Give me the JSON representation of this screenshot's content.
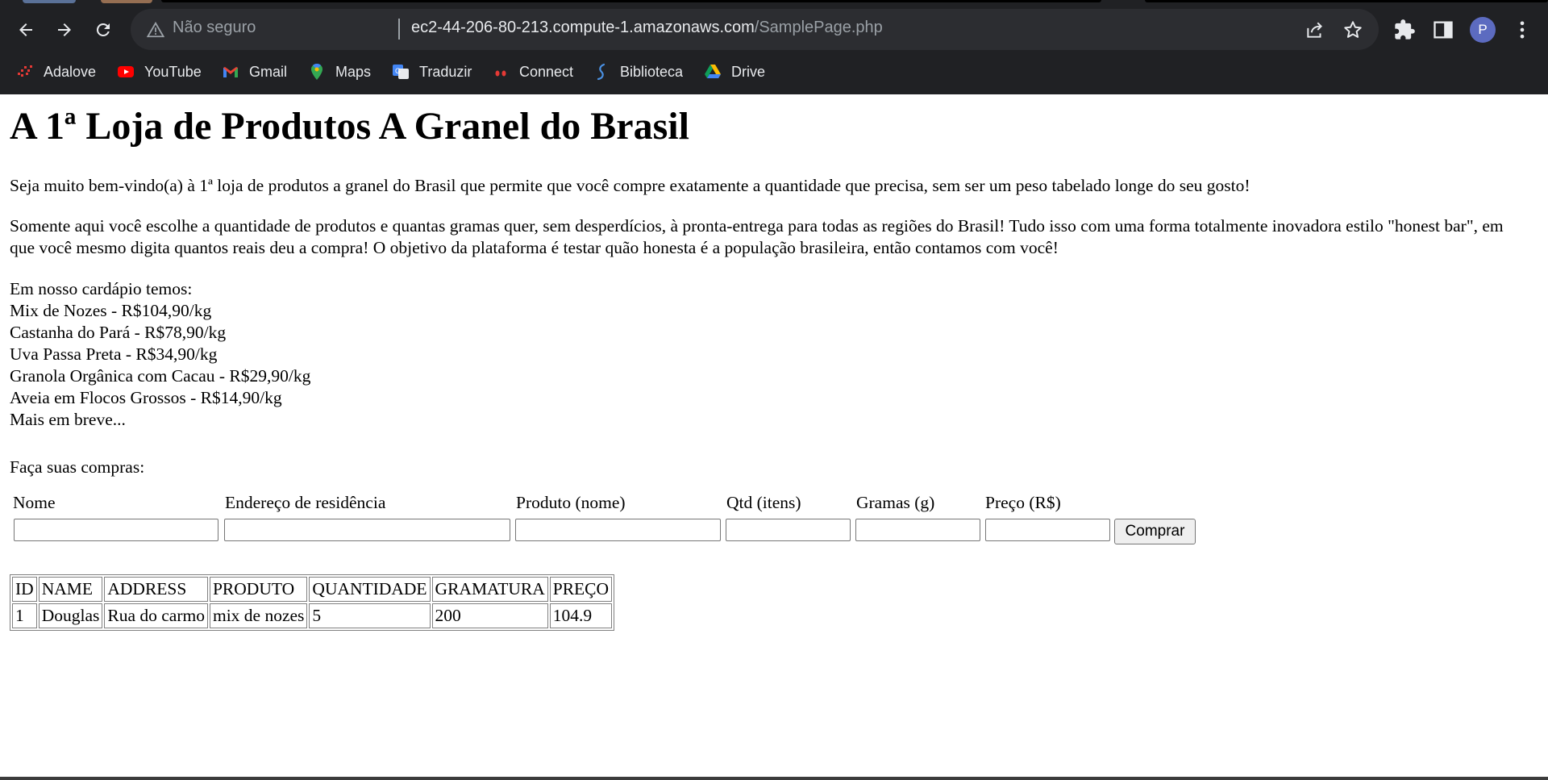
{
  "browser": {
    "security_label": "Não seguro",
    "url_host": "ec2-44-206-80-213.compute-1.amazonaws.com",
    "url_path": "/SamplePage.php",
    "profile_initial": "P",
    "bookmarks": [
      {
        "label": "Adalove",
        "icon": "adalove-icon"
      },
      {
        "label": "YouTube",
        "icon": "youtube-icon"
      },
      {
        "label": "Gmail",
        "icon": "gmail-icon"
      },
      {
        "label": "Maps",
        "icon": "maps-icon"
      },
      {
        "label": "Traduzir",
        "icon": "translate-icon"
      },
      {
        "label": "Connect",
        "icon": "connect-icon"
      },
      {
        "label": "Biblioteca",
        "icon": "biblioteca-icon"
      },
      {
        "label": "Drive",
        "icon": "drive-icon"
      }
    ]
  },
  "page": {
    "title": "A 1ª Loja de Produtos A Granel do Brasil",
    "intro": "Seja muito bem-vindo(a) à 1ª loja de produtos a granel do Brasil que permite que você compre exatamente a quantidade que precisa, sem ser um peso tabelado longe do seu gosto!",
    "description": "Somente aqui você escolhe a quantidade de produtos e quantas gramas quer, sem desperdícios, à pronta-entrega para todas as regiões do Brasil! Tudo isso com uma forma totalmente inovadora estilo \"honest bar\", em que você mesmo digita quantos reais deu a compra! O objetivo da plataforma é testar quão honesta é a população brasileira, então contamos com você!",
    "menu_heading": "Em nosso cardápio temos:",
    "menu_items": [
      "Mix de Nozes - R$104,90/kg",
      "Castanha do Pará - R$78,90/kg",
      "Uva Passa Preta - R$34,90/kg",
      "Granola Orgânica com Cacau - R$29,90/kg",
      "Aveia em Flocos Grossos - R$14,90/kg",
      "Mais em breve..."
    ],
    "buy_heading": "Faça suas compras:"
  },
  "form": {
    "labels": [
      "Nome",
      "Endereço de residência",
      "Produto (nome)",
      "Qtd (itens)",
      "Gramas (g)",
      "Preço (R$)"
    ],
    "values": [
      "",
      "",
      "",
      "",
      "",
      ""
    ],
    "submit_label": "Comprar"
  },
  "table": {
    "headers": [
      "ID",
      "NAME",
      "ADDRESS",
      "PRODUTO",
      "QUANTIDADE",
      "GRAMATURA",
      "PREÇO"
    ],
    "rows": [
      [
        "1",
        "Douglas",
        "Rua do carmo",
        "mix de nozes",
        "5",
        "200",
        "104.9"
      ]
    ]
  }
}
